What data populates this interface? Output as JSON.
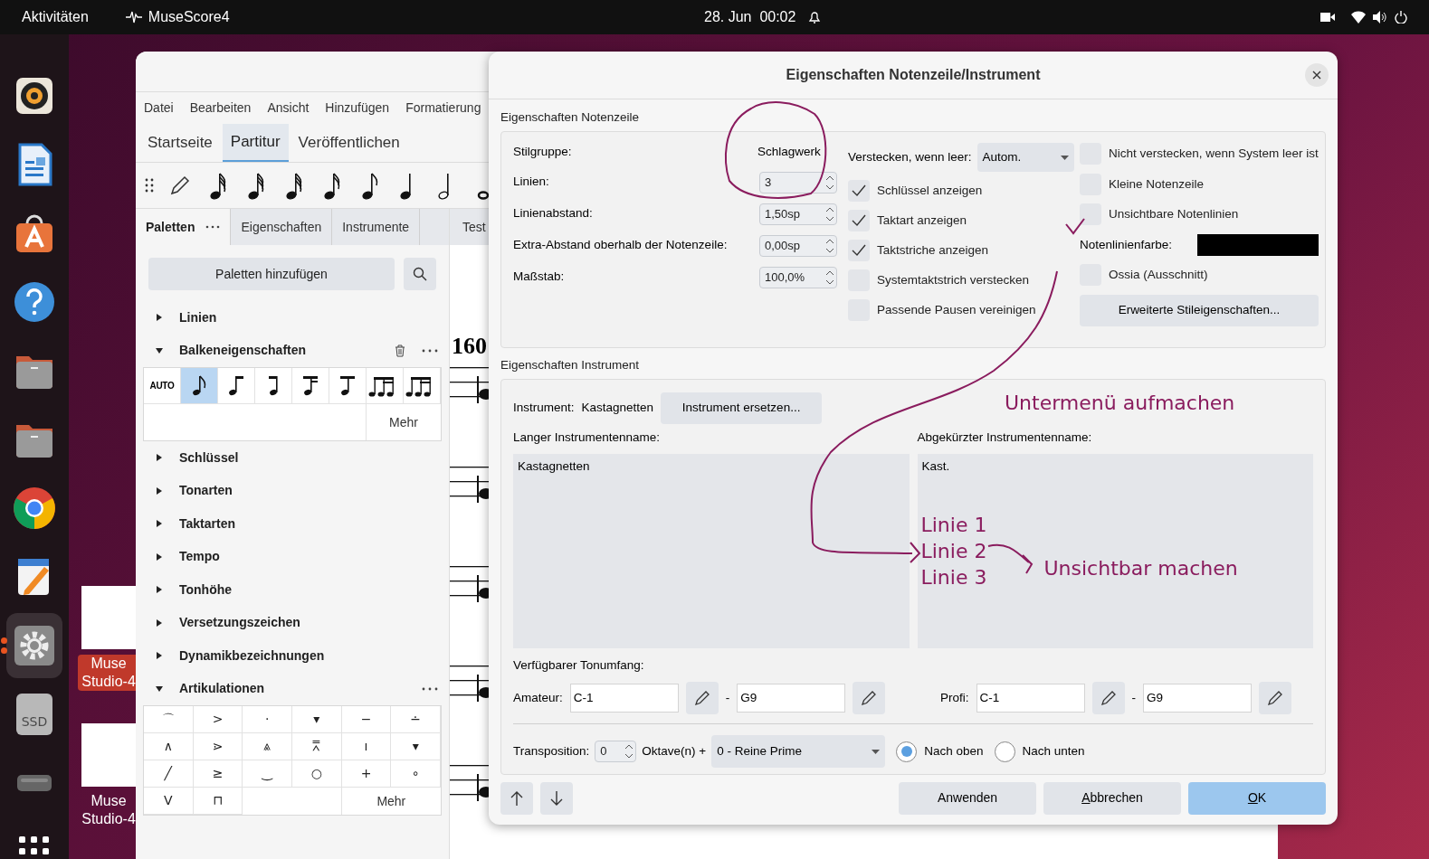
{
  "top_bar": {
    "activities": "Aktivitäten",
    "app": "MuseScore4",
    "clock": "28. Jun  00:02"
  },
  "dock": [
    {
      "kind": "speaker",
      "running": false
    },
    {
      "kind": "writer",
      "running": false
    },
    {
      "kind": "store",
      "running": false
    },
    {
      "kind": "help",
      "running": false
    },
    {
      "kind": "folder",
      "running": false
    },
    {
      "kind": "folder",
      "running": false
    },
    {
      "kind": "chrome",
      "running": false
    },
    {
      "kind": "editor",
      "running": false
    },
    {
      "kind": "settings",
      "running": true
    },
    {
      "kind": "ssd",
      "running": false,
      "label": "SSD"
    },
    {
      "kind": "drive",
      "running": false
    },
    {
      "kind": "apps",
      "running": false
    }
  ],
  "desktop_icons": [
    {
      "lines": [
        "Muse",
        "Studio-4"
      ],
      "selected": true
    },
    {
      "lines": [
        "Muse",
        "Studio-4"
      ],
      "selected": false
    }
  ],
  "musescore": {
    "menu": [
      "Datei",
      "Bearbeiten",
      "Ansicht",
      "Hinzufügen",
      "Formatierung"
    ],
    "tabs": [
      {
        "label": "Startseite",
        "selected": false
      },
      {
        "label": "Partitur",
        "selected": true
      },
      {
        "label": "Veröffentlichen",
        "selected": false
      }
    ],
    "panel_tabs": [
      {
        "label": "Paletten",
        "selected": true
      },
      {
        "label": "Eigenschaften",
        "selected": false
      },
      {
        "label": "Instrumente",
        "selected": false
      }
    ],
    "score_tab": "Test",
    "add_palettes": "Paletten hinzufügen",
    "palettes": [
      {
        "label": "Linien",
        "expanded": false
      },
      {
        "label": "Balkeneigenschaften",
        "expanded": true,
        "kind": "beams",
        "cells": [
          {
            "kind": "auto",
            "label": "AUTO",
            "selected": false
          },
          {
            "kind": "note",
            "selected": true
          },
          {
            "kind": "beam1",
            "selected": false
          },
          {
            "kind": "beam2",
            "selected": false
          },
          {
            "kind": "beam3",
            "selected": false
          },
          {
            "kind": "beam4",
            "selected": false
          },
          {
            "kind": "group",
            "selected": false
          },
          {
            "kind": "group",
            "selected": false
          }
        ],
        "more": "Mehr"
      },
      {
        "label": "Schlüssel",
        "expanded": false
      },
      {
        "label": "Tonarten",
        "expanded": false
      },
      {
        "label": "Taktarten",
        "expanded": false
      },
      {
        "label": "Tempo",
        "expanded": false
      },
      {
        "label": "Tonhöhe",
        "expanded": false
      },
      {
        "label": "Versetzungszeichen",
        "expanded": false
      },
      {
        "label": "Dynamikbezeichnungen",
        "expanded": false
      },
      {
        "label": "Artikulationen",
        "expanded": true,
        "kind": "articulations",
        "symbols": [
          "⌒",
          ">",
          "·",
          "▾",
          "−",
          "∸",
          "∧",
          "⋗",
          "⩓",
          "⩞",
          "ı",
          "▾",
          "╱",
          "≥",
          "‿",
          "○",
          "+",
          "∘",
          "V",
          "⊓"
        ],
        "more": "Mehr"
      }
    ],
    "score": {
      "tempo": "160"
    }
  },
  "dialog": {
    "title": "Eigenschaften Notenzeile/Instrument",
    "staff_section": "Eigenschaften Notenzeile",
    "style_group": {
      "label": "Stilgruppe:",
      "value": "Schlagwerk"
    },
    "spins": [
      {
        "label": "Linien:",
        "value": "3"
      },
      {
        "label": "Linienabstand:",
        "value": "1,50sp"
      },
      {
        "label": "Extra-Abstand oberhalb der Notenzeile:",
        "value": "0,00sp"
      },
      {
        "label": "Maßstab:",
        "value": "100,0%"
      }
    ],
    "hide_when_empty": {
      "label": "Verstecken, wenn leer:",
      "value": "Autom."
    },
    "checks_middle": [
      {
        "label": "Schlüssel anzeigen",
        "checked": true
      },
      {
        "label": "Taktart anzeigen",
        "checked": true
      },
      {
        "label": "Taktstriche anzeigen",
        "checked": true
      },
      {
        "label": "Systemtaktstrich verstecken",
        "checked": false
      },
      {
        "label": "Passende Pausen vereinigen",
        "checked": false
      }
    ],
    "checks_right": [
      {
        "label": "Nicht verstecken, wenn System leer ist",
        "checked": false
      },
      {
        "label": "Kleine Notenzeile",
        "checked": false
      },
      {
        "label": "Unsichtbare Notenlinien",
        "checked": false
      }
    ],
    "staff_color": {
      "label": "Notenlinienfarbe:",
      "color": "#000000"
    },
    "ossia": {
      "label": "Ossia (Ausschnitt)",
      "checked": false
    },
    "advanced_button": "Erweiterte Stileigenschaften...",
    "instrument_section": "Eigenschaften Instrument",
    "instrument": {
      "label": "Instrument:",
      "value": "Kastagnetten",
      "button": "Instrument ersetzen..."
    },
    "long_name": {
      "label": "Langer Instrumentenname:",
      "value": "Kastagnetten"
    },
    "short_name": {
      "label": "Abgekürzter Instrumentenname:",
      "value": "Kast."
    },
    "range_label": "Verfügbarer Tonumfang:",
    "ranges": [
      {
        "label": "Amateur:",
        "low": "C-1",
        "high": "G9"
      },
      {
        "label": "Profi:",
        "low": "C-1",
        "high": "G9"
      }
    ],
    "range_separator": "-",
    "transposition": {
      "label": "Transposition:",
      "octaves": "0",
      "octaves_label": "Oktave(n) +",
      "interval": "0 - Reine Prime"
    },
    "directions": [
      {
        "label": "Nach oben",
        "selected": true
      },
      {
        "label": "Nach unten",
        "selected": false
      }
    ],
    "buttons": [
      {
        "label": "Anwenden",
        "kind": "normal"
      },
      {
        "label": "Abbrechen",
        "kind": "normal"
      },
      {
        "label": "OK",
        "kind": "primary"
      }
    ]
  },
  "annotations": [
    {
      "text": "Untermenü aufmachen"
    },
    {
      "text": "Linie 1"
    },
    {
      "text": "Linie 2"
    },
    {
      "text": "Linie 3"
    },
    {
      "text": "Unsichtbar machen"
    }
  ]
}
